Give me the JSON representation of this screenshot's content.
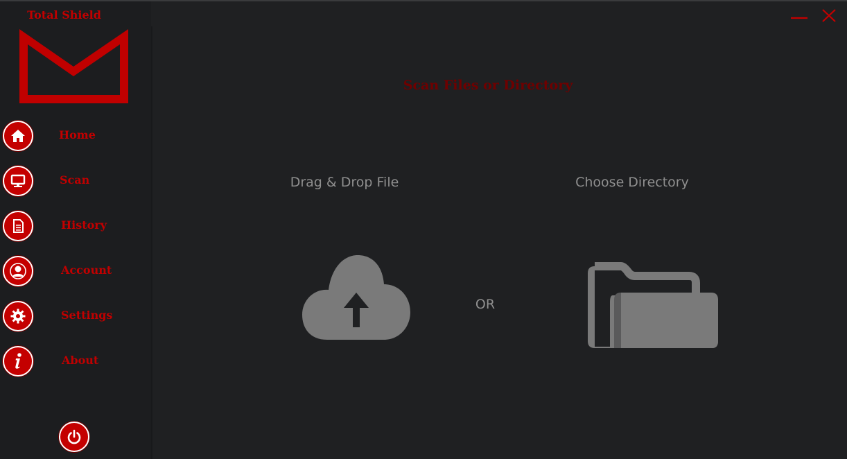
{
  "app": {
    "title": "Total Shield"
  },
  "window_controls": {
    "minimize_icon": "minimize-icon",
    "close_icon": "close-icon"
  },
  "sidebar": {
    "items": [
      {
        "label": "Home",
        "icon": "home-icon"
      },
      {
        "label": "Scan",
        "icon": "monitor-icon"
      },
      {
        "label": "History",
        "icon": "document-icon"
      },
      {
        "label": "Account",
        "icon": "user-icon"
      },
      {
        "label": "Settings",
        "icon": "gear-icon"
      },
      {
        "label": "About",
        "icon": "info-icon"
      }
    ],
    "power_icon": "power-icon"
  },
  "main": {
    "title": "Scan Files or Directory",
    "drag_drop_label": "Drag & Drop File",
    "or_label": "OR",
    "choose_directory_label": "Choose Directory",
    "upload_icon": "cloud-upload-icon",
    "folder_icon": "folder-icon"
  },
  "colors": {
    "accent": "#c40000",
    "background": "#1f2022",
    "muted_text": "#8f8f8f",
    "title_dark_red": "#6f0000"
  }
}
